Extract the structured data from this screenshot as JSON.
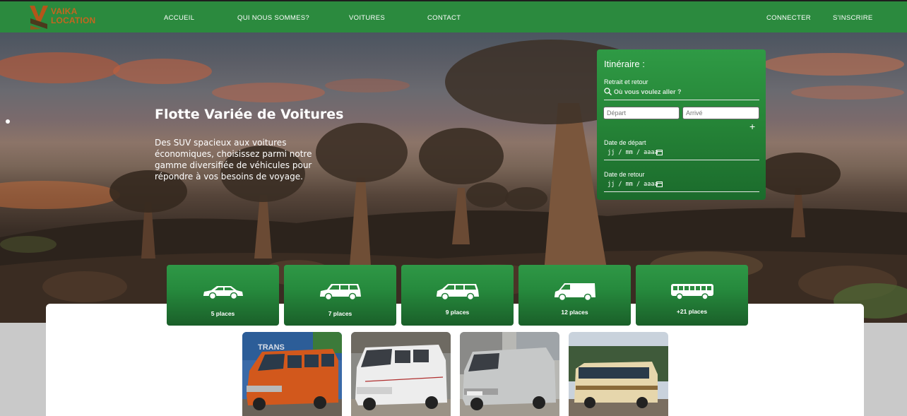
{
  "brand": {
    "line1": "VAIKA",
    "line2": "LOCATION",
    "color_primary": "#c3661f",
    "color_nav": "#2b8a3e"
  },
  "nav": {
    "accueil": "ACCUEIL",
    "about": "QUI NOUS SOMMES?",
    "voitures": "VOITURES",
    "contact": "CONTACT",
    "login": "CONNECTER",
    "signup": "S'INSCRIRE"
  },
  "hero": {
    "title": "Flotte Variée de Voitures",
    "description": "Des SUV spacieux aux voitures économiques, choisissez parmi notre gamme diversifiée de véhicules pour répondre à vos besoins de voyage."
  },
  "booking": {
    "title": "Itinéraire :",
    "pickup_label": "Retrait et retour",
    "search_placeholder": "Où vous voulez aller ?",
    "depart_placeholder": "Départ",
    "arrive_placeholder": "Arrivé",
    "add_symbol": "+",
    "date_depart_label": "Date de départ",
    "date_depart_value": "jj / mm / aaaa",
    "date_retour_label": "Date de retour",
    "date_retour_value": "jj / mm / aaaa"
  },
  "categories": [
    {
      "label": "5 places",
      "icon": "car-icon"
    },
    {
      "label": "7 places",
      "icon": "minivan-icon"
    },
    {
      "label": "9 places",
      "icon": "van-icon"
    },
    {
      "label": "12 places",
      "icon": "large-van-icon"
    },
    {
      "label": "+21 places",
      "icon": "bus-icon"
    }
  ],
  "vehicles": [
    {
      "name": "orange-minibus-photo"
    },
    {
      "name": "white-sprinter-photo"
    },
    {
      "name": "silver-sprinter-photo"
    },
    {
      "name": "cream-coaster-bus-photo"
    }
  ]
}
